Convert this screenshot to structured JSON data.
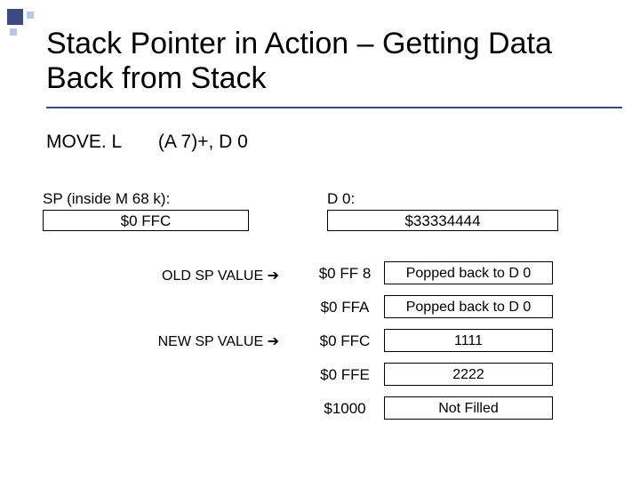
{
  "title": "Stack Pointer in Action – Getting Data Back from Stack",
  "instruction": {
    "mnemonic": "MOVE. L",
    "operands": "(A 7)+, D 0"
  },
  "sp": {
    "label": "SP (inside M 68 k):",
    "value": "$0 FFC"
  },
  "d0": {
    "label": "D 0:",
    "value": "$33334444"
  },
  "pointers": {
    "old": "OLD SP VALUE ➔",
    "new": "NEW SP VALUE ➔"
  },
  "memory": [
    {
      "addr": "$0 FF 8",
      "content": "Popped back to D 0"
    },
    {
      "addr": "$0 FFA",
      "content": "Popped back to D 0"
    },
    {
      "addr": "$0 FFC",
      "content": "1111"
    },
    {
      "addr": "$0 FFE",
      "content": "2222"
    },
    {
      "addr": "$1000",
      "content": "Not Filled"
    }
  ]
}
